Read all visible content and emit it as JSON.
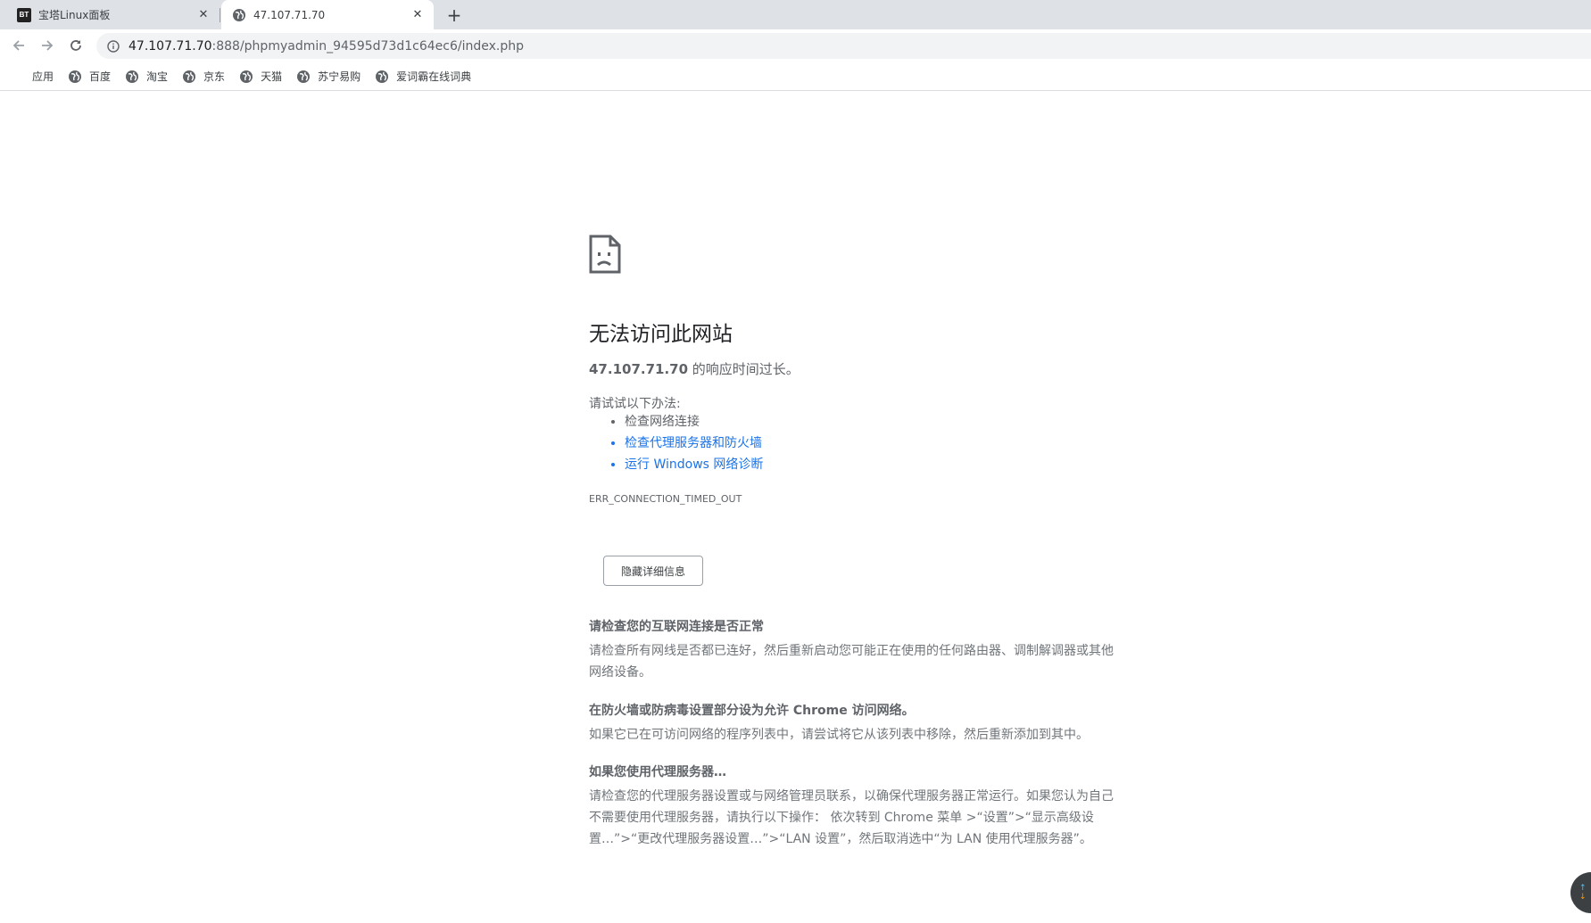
{
  "tabs": [
    {
      "title": "宝塔Linux面板",
      "favicon": "bt-logo-icon",
      "active": false
    },
    {
      "title": "47.107.71.70",
      "favicon": "globe-icon",
      "active": true
    }
  ],
  "toolbar": {
    "url_host": "47.107.71.70",
    "url_rest": ":888/phpmyadmin_94595d73d1c64ec6/index.php"
  },
  "bookmarks": [
    {
      "label": "应用",
      "icon": "apps-grid-icon"
    },
    {
      "label": "百度",
      "icon": "globe-icon"
    },
    {
      "label": "淘宝",
      "icon": "globe-icon"
    },
    {
      "label": "京东",
      "icon": "globe-icon"
    },
    {
      "label": "天猫",
      "icon": "globe-icon"
    },
    {
      "label": "苏宁易购",
      "icon": "globe-icon"
    },
    {
      "label": "爱词霸在线词典",
      "icon": "globe-icon"
    }
  ],
  "error": {
    "heading": "无法访问此网站",
    "host": "47.107.71.70",
    "summary_suffix": " 的响应时间过长。",
    "try_label": "请试试以下办法:",
    "suggestions": [
      {
        "text": "检查网络连接",
        "link": false
      },
      {
        "text": "检查代理服务器和防火墙",
        "link": true
      },
      {
        "text": "运行 Windows 网络诊断",
        "link": true
      }
    ],
    "code": "ERR_CONNECTION_TIMED_OUT",
    "details_button": "隐藏详细信息",
    "details": [
      {
        "title": "请检查您的互联网连接是否正常",
        "body": "请检查所有网线是否都已连好，然后重新启动您可能正在使用的任何路由器、调制解调器或其他网络设备。"
      },
      {
        "title": "在防火墙或防病毒设置部分设为允许 Chrome 访问网络。",
        "body": "如果它已在可访问网络的程序列表中，请尝试将它从该列表中移除，然后重新添加到其中。"
      },
      {
        "title": "如果您使用代理服务器…",
        "body": "请检查您的代理服务器设置或与网络管理员联系，以确保代理服务器正常运行。如果您认为自己不需要使用代理服务器，请执行以下操作： 依次转到 Chrome 菜单 >“设置”>“显示高级设置…”>“更改代理服务器设置…”>“LAN 设置”，然后取消选中“为 LAN 使用代理服务器”。"
      }
    ]
  },
  "colors": {
    "tabstrip_bg": "#dee1e6",
    "link": "#1a73e8",
    "secondary_text": "#5f6368"
  }
}
